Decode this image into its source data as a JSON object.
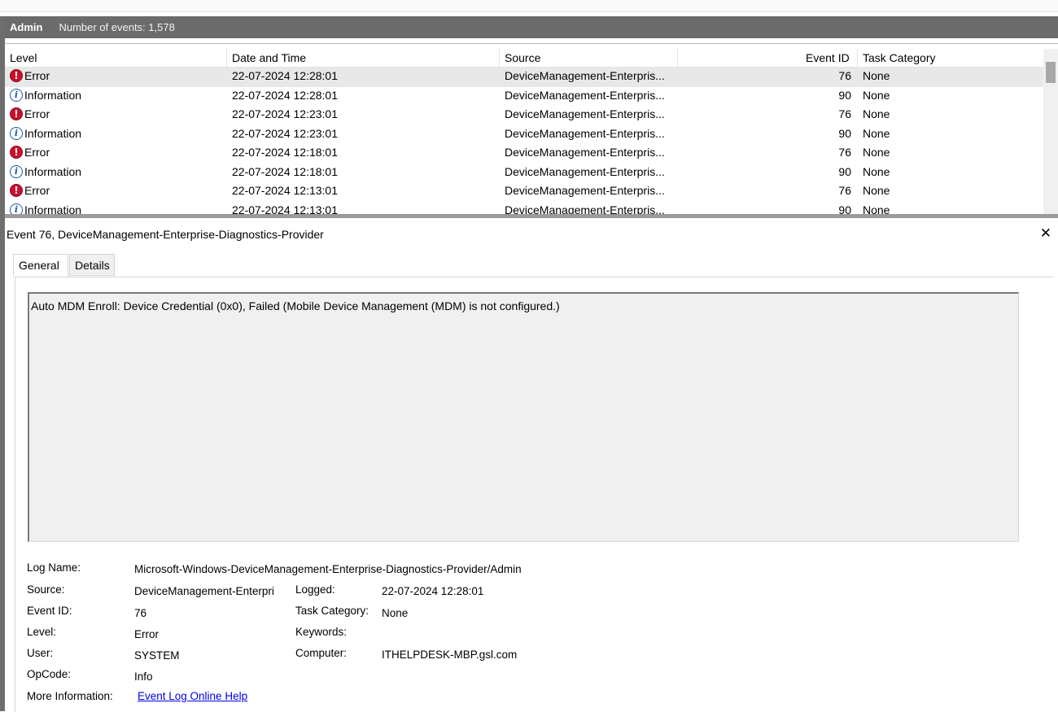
{
  "header": {
    "title": "Admin",
    "count_text": "Number of events: 1,578"
  },
  "columns": {
    "level": "Level",
    "date": "Date and Time",
    "source": "Source",
    "event_id": "Event ID",
    "task": "Task Category"
  },
  "rows": [
    {
      "level": "Error",
      "icon": "error-icon",
      "date": "22-07-2024 12:28:01",
      "source": "DeviceManagement-Enterpris...",
      "event_id": "76",
      "task": "None"
    },
    {
      "level": "Information",
      "icon": "information-icon",
      "date": "22-07-2024 12:28:01",
      "source": "DeviceManagement-Enterpris...",
      "event_id": "90",
      "task": "None"
    },
    {
      "level": "Error",
      "icon": "error-icon",
      "date": "22-07-2024 12:23:01",
      "source": "DeviceManagement-Enterpris...",
      "event_id": "76",
      "task": "None"
    },
    {
      "level": "Information",
      "icon": "information-icon",
      "date": "22-07-2024 12:23:01",
      "source": "DeviceManagement-Enterpris...",
      "event_id": "90",
      "task": "None"
    },
    {
      "level": "Error",
      "icon": "error-icon",
      "date": "22-07-2024 12:18:01",
      "source": "DeviceManagement-Enterpris...",
      "event_id": "76",
      "task": "None"
    },
    {
      "level": "Information",
      "icon": "information-icon",
      "date": "22-07-2024 12:18:01",
      "source": "DeviceManagement-Enterpris...",
      "event_id": "90",
      "task": "None"
    },
    {
      "level": "Error",
      "icon": "error-icon",
      "date": "22-07-2024 12:13:01",
      "source": "DeviceManagement-Enterpris...",
      "event_id": "76",
      "task": "None"
    },
    {
      "level": "Information",
      "icon": "information-icon",
      "date": "22-07-2024 12:13:01",
      "source": "DeviceManagement-Enterpris...",
      "event_id": "90",
      "task": "None"
    }
  ],
  "detail": {
    "title": "Event 76, DeviceManagement-Enterprise-Diagnostics-Provider",
    "tabs": {
      "general": "General",
      "details": "Details"
    },
    "message": "Auto MDM Enroll: Device Credential (0x0), Failed (Mobile Device Management (MDM) is not configured.)",
    "labels": {
      "log_name": "Log Name:",
      "source": "Source:",
      "event_id": "Event ID:",
      "level": "Level:",
      "user": "User:",
      "opcode": "OpCode:",
      "more_info": "More Information:",
      "logged": "Logged:",
      "task_category": "Task Category:",
      "keywords": "Keywords:",
      "computer": "Computer:"
    },
    "values": {
      "log_name": "Microsoft-Windows-DeviceManagement-Enterprise-Diagnostics-Provider/Admin",
      "source": "DeviceManagement-Enterpri",
      "event_id": "76",
      "level": "Error",
      "user": "SYSTEM",
      "opcode": "Info",
      "more_info_link": "Event Log Online Help",
      "logged": "22-07-2024 12:28:01",
      "task_category": "None",
      "keywords": "",
      "computer": "ITHELPDESK-MBP.gsl.com"
    }
  },
  "colors": {
    "header_bg": "#6b6b6b",
    "error_red": "#c8102e",
    "info_blue": "#1e5aa8",
    "link_blue": "#0000ee",
    "selected_row": "#e8e8e8"
  }
}
